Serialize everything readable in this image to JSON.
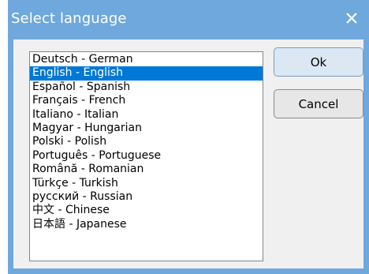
{
  "window": {
    "title": "Select language",
    "close_symbol": "×"
  },
  "languages": {
    "selected_index": 1,
    "items": [
      "Deutsch - German",
      "English - English",
      "Español - Spanish",
      "Français - French",
      "Italiano - Italian",
      "Magyar - Hungarian",
      "Polski - Polish",
      "Português - Portuguese",
      "Română - Romanian",
      "Türkçe - Turkish",
      "русский - Russian",
      "中文 - Chinese",
      "日本語 - Japanese"
    ]
  },
  "buttons": {
    "ok_label": "Ok",
    "cancel_label": "Cancel"
  },
  "colors": {
    "title_bar": "#6fa8dc",
    "selection": "#0078d7",
    "dialog_bg": "#f0f0f0"
  }
}
